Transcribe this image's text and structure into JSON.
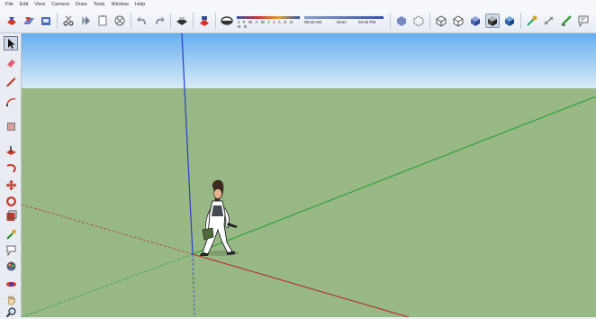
{
  "menu": [
    "File",
    "Edit",
    "View",
    "Camera",
    "Draw",
    "Tools",
    "Window",
    "Help"
  ],
  "toolbar": {
    "icons": [
      "get-models-icon",
      "share-model-icon",
      "share-component-icon",
      "cut-icon",
      "copy-icon",
      "paste-icon",
      "erase-icon",
      "undo-icon",
      "redo-icon",
      "print-icon",
      "model-info-icon",
      "shadows-toggle-icon"
    ],
    "shadow_months": "J F M A M J J A S O N D",
    "shadow_time_start": "06:43 AM",
    "shadow_time_mid": "Noon",
    "shadow_time_end": "04:45 PM",
    "style_icons": [
      "xray-icon",
      "back-edges-icon",
      "wireframe-icon",
      "hidden-line-icon",
      "shaded-icon",
      "shaded-textures-icon",
      "monochrome-icon"
    ],
    "extra_icons": [
      "tape-measure-icon",
      "dimension-icon",
      "protractor-icon",
      "text-icon",
      "axes-icon",
      "3d-text-icon",
      "warehouse-icon",
      "extension-icon"
    ]
  },
  "sidebar_tools": [
    "select-icon",
    "eraser-icon",
    "pencil-icon",
    "arc-icon",
    "rectangle-icon",
    "push-pull-icon",
    "follow-me-icon",
    "move-icon",
    "rotate-icon",
    "scale-icon",
    "tape-icon",
    "text-tool-icon",
    "paint-bucket-icon",
    "orbit-icon",
    "pan-icon",
    "zoom-icon"
  ],
  "colors": {
    "sky_top": "#66aef0",
    "sky_bottom": "#dcebf7",
    "ground": "#98b886",
    "axis_red": "#b03a2e",
    "axis_green": "#2fa03a",
    "axis_blue": "#2a3fc8"
  }
}
